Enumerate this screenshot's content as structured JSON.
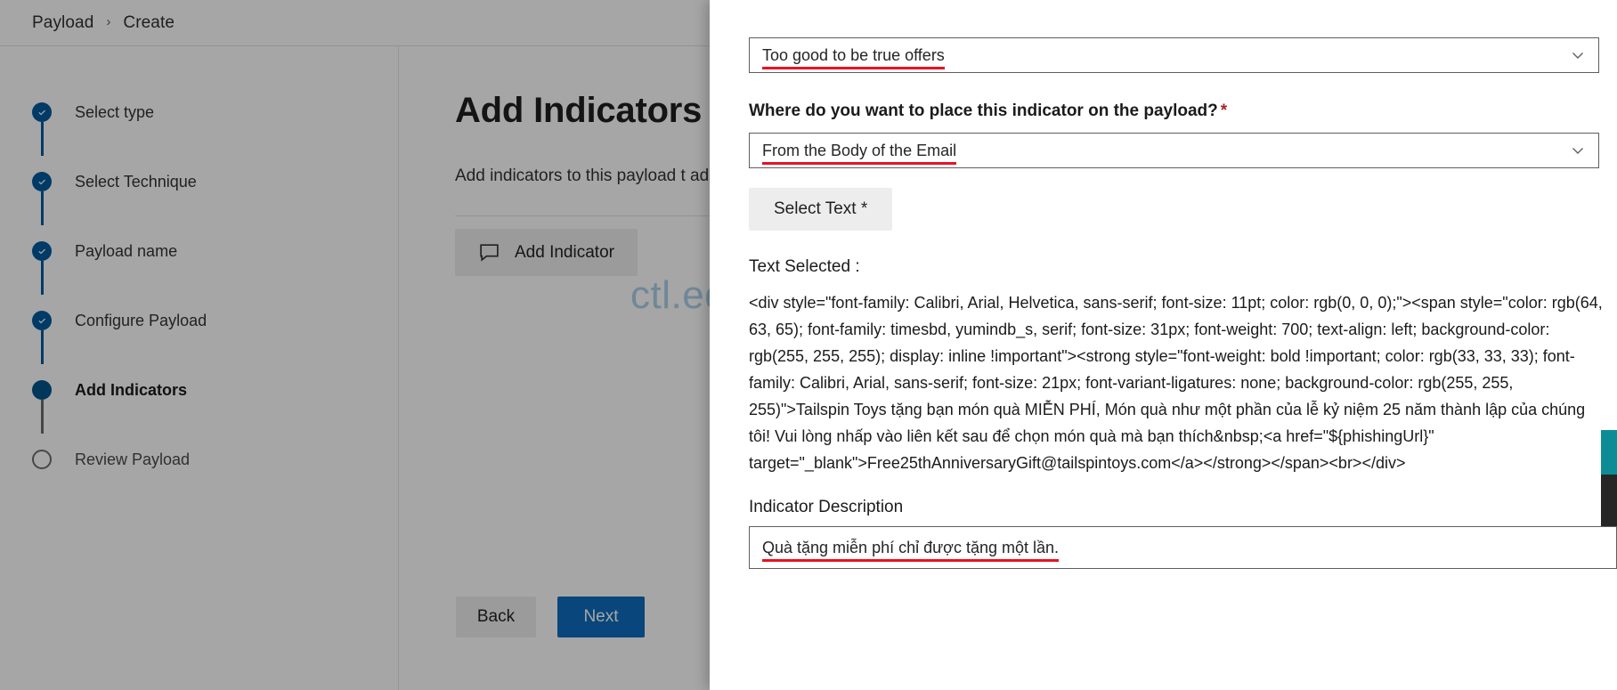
{
  "breadcrumb": {
    "root": "Payload",
    "separator": "›",
    "current": "Create"
  },
  "wizard": {
    "steps": [
      {
        "label": "Select type",
        "state": "done"
      },
      {
        "label": "Select Technique",
        "state": "done"
      },
      {
        "label": "Payload name",
        "state": "done"
      },
      {
        "label": "Configure Payload",
        "state": "done"
      },
      {
        "label": "Add Indicators",
        "state": "current"
      },
      {
        "label": "Review Payload",
        "state": "todo"
      }
    ]
  },
  "main": {
    "title": "Add Indicators",
    "description": "Add indicators to this payload t\nadd indicator button to simply",
    "add_indicator_label": "Add Indicator",
    "watermark": "ctl.edu.vn",
    "back_label": "Back",
    "next_label": "Next"
  },
  "panel": {
    "indicator_type": {
      "value": "Too good to be true offers"
    },
    "placement": {
      "label": "Where do you want to place this indicator on the payload?",
      "required_mark": "*",
      "value": "From the Body of the Email"
    },
    "select_text_button": "Select Text *",
    "text_selected_label": "Text Selected :",
    "text_selected_value": "<div style=\"font-family: Calibri, Arial, Helvetica, sans-serif; font-size: 11pt; color: rgb(0, 0, 0);\"><span style=\"color: rgb(64, 63, 65); font-family: timesbd, yumindb_s, serif; font-size: 31px; font-weight: 700; text-align: left; background-color: rgb(255, 255, 255); display: inline !important\"><strong style=\"font-weight: bold !important; color: rgb(33, 33, 33); font-family: Calibri, Arial, sans-serif; font-size: 21px; font-variant-ligatures: none; background-color: rgb(255, 255, 255)\">Tailspin Toys tặng bạn món quà MIỄN PHÍ, Món quà như một phần của lễ kỷ niệm 25 năm thành lập của chúng tôi! Vui lòng nhấp vào liên kết sau để chọn món quà mà bạn thích&nbsp;<a href=\"${phishingUrl}\" target=\"_blank\">Free25thAnniversaryGift@tailspintoys.com</a></strong></span><br></div>",
    "indicator_description": {
      "label": "Indicator Description",
      "value": "Quà tặng miễn phí chỉ được tặng một lần."
    }
  },
  "colors": {
    "accent_blue": "#0f6cbd",
    "step_done": "#005a9e",
    "required_red": "#a4262c",
    "underline_red": "#e81123",
    "teal_block": "#0e8c95",
    "dark_block": "#262626"
  }
}
